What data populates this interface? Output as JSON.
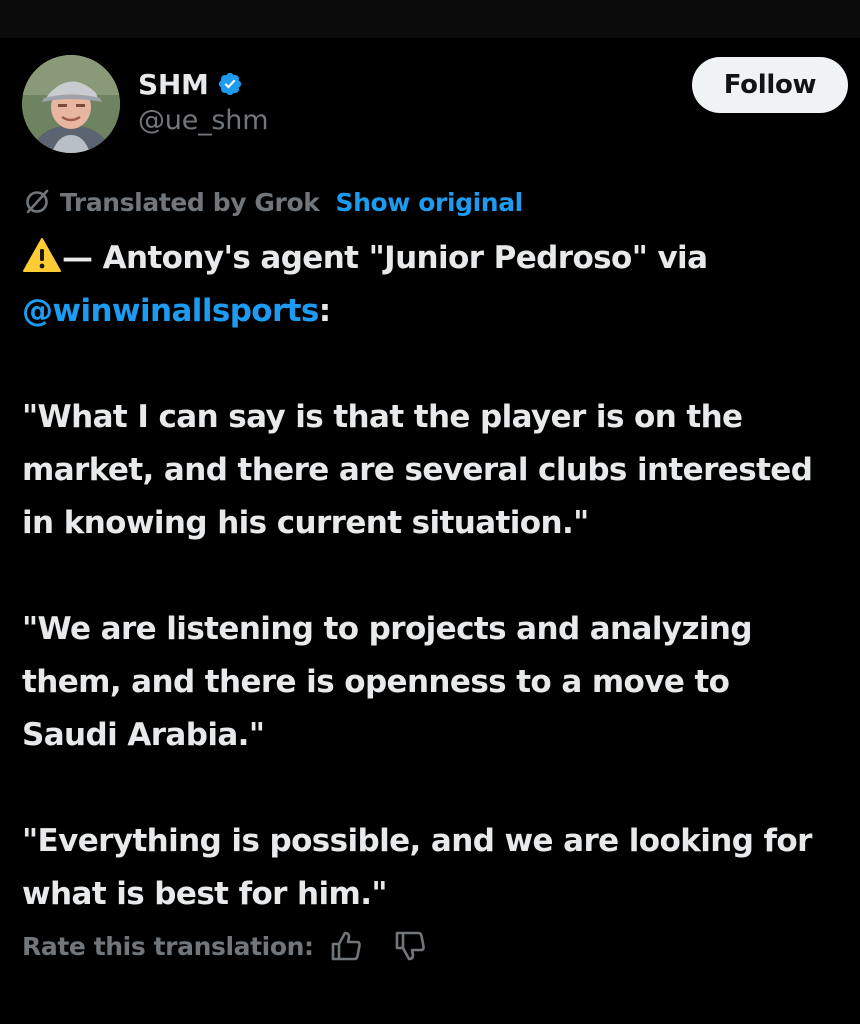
{
  "tweet": {
    "author": {
      "display_name": "SHM",
      "handle": "@ue_shm",
      "verified": true,
      "avatar_icon": "avatar-photo"
    },
    "follow_label": "Follow",
    "translation": {
      "translated_by": "Translated by Grok",
      "show_original": "Show original",
      "icon": "grok-icon"
    },
    "body": {
      "line1_text": "— Antony's agent \"Junior Pedroso\" via",
      "mention": "@winwinallsports",
      "mention_suffix": ":",
      "quote1": [
        "\"What I can say is that the player is on the",
        "market, and there are several clubs interested",
        "in knowing his current situation.\""
      ],
      "quote2": [
        "\"We are listening to projects and analyzing",
        "them, and there is openness to a move to",
        "Saudi Arabia.\""
      ],
      "quote3": [
        "\"Everything is possible, and we are looking for",
        "what is best for him.\""
      ]
    },
    "rate": {
      "label": "Rate this translation:",
      "up_icon": "thumbs-up-icon",
      "down_icon": "thumbs-down-icon"
    }
  },
  "colors": {
    "background": "#000000",
    "text": "#e7e9ea",
    "muted": "#71767b",
    "accent": "#1d9bf0",
    "follow_bg": "#eff3f4",
    "warning": "#ffcc33"
  }
}
